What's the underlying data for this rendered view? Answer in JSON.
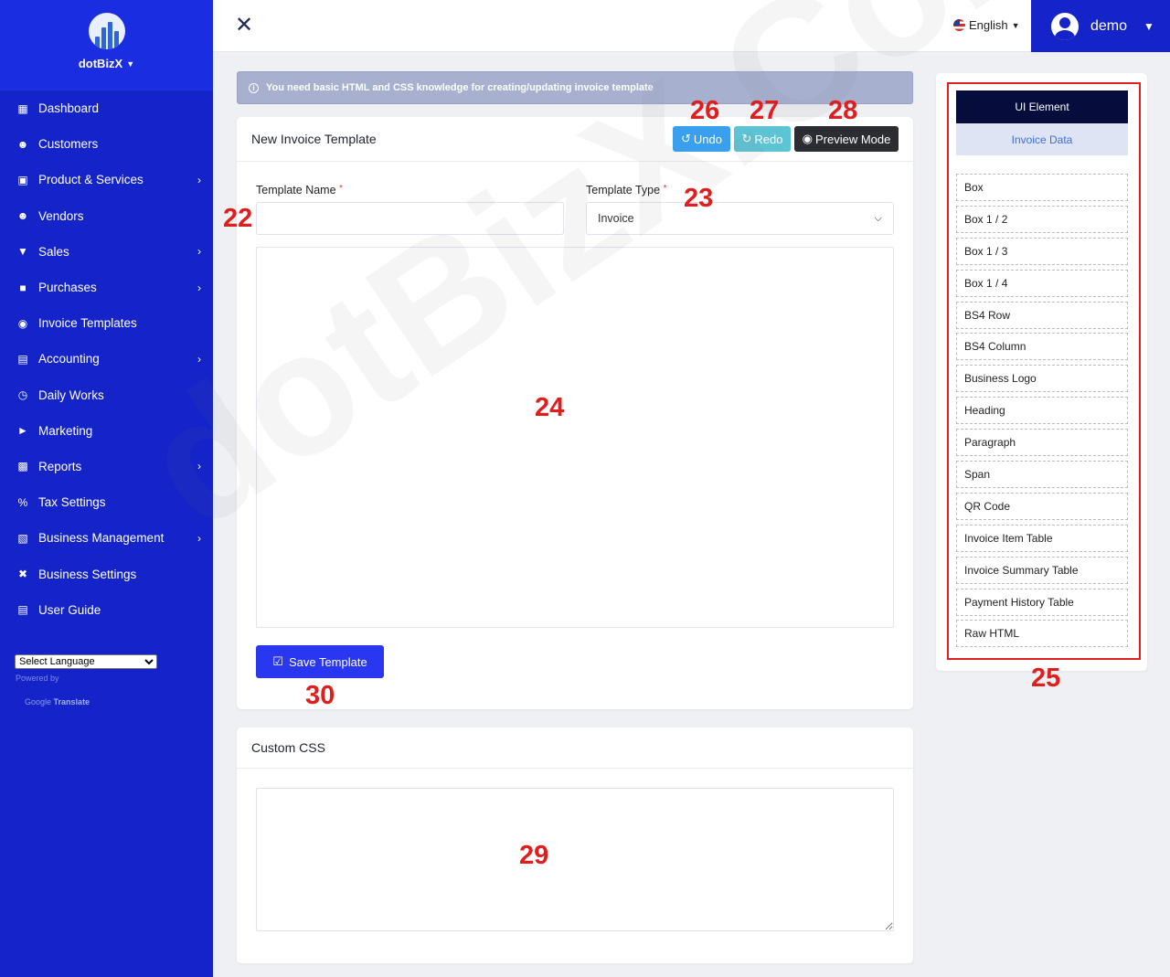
{
  "brand": {
    "name": "dotBizX"
  },
  "sidebar": {
    "items": [
      {
        "label": "Dashboard",
        "icon": "dashboard-icon",
        "has_arrow": false
      },
      {
        "label": "Customers",
        "icon": "users-icon",
        "has_arrow": false
      },
      {
        "label": "Product & Services",
        "icon": "box-icon",
        "has_arrow": true
      },
      {
        "label": "Vendors",
        "icon": "users-icon",
        "has_arrow": false
      },
      {
        "label": "Sales",
        "icon": "basket-icon",
        "has_arrow": true
      },
      {
        "label": "Purchases",
        "icon": "bag-icon",
        "has_arrow": true
      },
      {
        "label": "Invoice Templates",
        "icon": "palette-icon",
        "has_arrow": false
      },
      {
        "label": "Accounting",
        "icon": "bank-icon",
        "has_arrow": true
      },
      {
        "label": "Daily Works",
        "icon": "clock-icon",
        "has_arrow": false
      },
      {
        "label": "Marketing",
        "icon": "megaphone-icon",
        "has_arrow": false
      },
      {
        "label": "Reports",
        "icon": "chart-icon",
        "has_arrow": true
      },
      {
        "label": "Tax Settings",
        "icon": "percent-icon",
        "has_arrow": false
      },
      {
        "label": "Business Management",
        "icon": "building-icon",
        "has_arrow": true
      },
      {
        "label": "Business Settings",
        "icon": "tools-icon",
        "has_arrow": false
      },
      {
        "label": "User Guide",
        "icon": "book-icon",
        "has_arrow": false
      }
    ],
    "language_select": "Select Language",
    "powered_by": "Powered by",
    "google": "Google",
    "translate": "Translate"
  },
  "topbar": {
    "language": "English",
    "username": "demo"
  },
  "info": {
    "icon": "info-icon",
    "message": "You need basic HTML and CSS knowledge for creating/updating invoice template"
  },
  "template_card": {
    "title": "New Invoice Template",
    "undo_label": "Undo",
    "redo_label": "Redo",
    "preview_label": "Preview Mode",
    "name_label": "Template Name",
    "name_value": "",
    "type_label": "Template Type",
    "type_value": "Invoice",
    "required_mark": "*",
    "save_label": "Save Template"
  },
  "css_card": {
    "title": "Custom CSS",
    "value": ""
  },
  "right_panel": {
    "tab_ui": "UI Element",
    "tab_data": "Invoice Data",
    "elements": [
      "Box",
      "Box 1 / 2",
      "Box 1 / 3",
      "Box 1 / 4",
      "BS4 Row",
      "BS4 Column",
      "Business Logo",
      "Heading",
      "Paragraph",
      "Span",
      "QR Code",
      "Invoice Item Table",
      "Invoice Summary Table",
      "Payment History Table",
      "Raw HTML"
    ]
  },
  "annotations": {
    "a22": "22",
    "a23": "23",
    "a24": "24",
    "a25": "25",
    "a26": "26",
    "a27": "27",
    "a28": "28",
    "a29": "29",
    "a30": "30"
  },
  "watermark": "dotBizX.Com",
  "colors": {
    "sidebar": "#1424c8",
    "accent": "#2a37f0",
    "undo": "#3aa0ee",
    "redo": "#5ec3d4",
    "preview": "#2b2d33",
    "annotation": "#e01e1e"
  }
}
